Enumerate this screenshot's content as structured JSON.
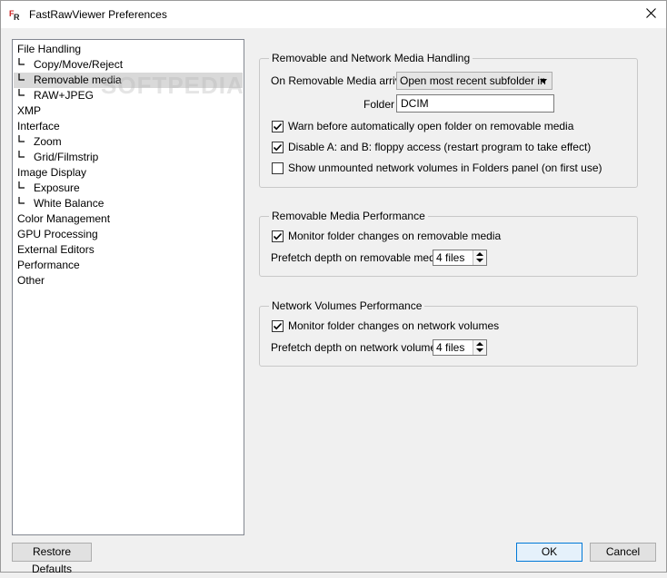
{
  "window": {
    "title": "FastRawViewer Preferences"
  },
  "icons": {
    "app": "fastrawviewer-app-icon",
    "close": "close-icon"
  },
  "watermark": "SOFTPEDIA",
  "nav": {
    "items": [
      {
        "label": "File Handling",
        "prefix": ""
      },
      {
        "label": "Copy/Move/Reject",
        "prefix": "L▸"
      },
      {
        "label": "Removable media",
        "prefix": "L▸"
      },
      {
        "label": "RAW+JPEG",
        "prefix": "L▸"
      },
      {
        "label": "XMP",
        "prefix": ""
      },
      {
        "label": "Interface",
        "prefix": ""
      },
      {
        "label": "Zoom",
        "prefix": "L▸"
      },
      {
        "label": "Grid/Filmstrip",
        "prefix": "L▸"
      },
      {
        "label": "Image Display",
        "prefix": ""
      },
      {
        "label": "Exposure",
        "prefix": "L▸"
      },
      {
        "label": "White Balance",
        "prefix": "L▸"
      },
      {
        "label": "Color Management",
        "prefix": ""
      },
      {
        "label": "GPU Processing",
        "prefix": ""
      },
      {
        "label": "External Editors",
        "prefix": ""
      },
      {
        "label": "Performance",
        "prefix": ""
      },
      {
        "label": "Other",
        "prefix": ""
      }
    ]
  },
  "group1": {
    "title": "Removable and Network Media Handling",
    "arrive_label": "On Removable Media arrive",
    "arrive_value": "Open most recent subfolder in",
    "folder_label": "Folder",
    "folder_value": "DCIM",
    "checks": [
      {
        "label": "Warn before automatically open folder on removable media",
        "checked": true
      },
      {
        "label": "Disable A: and B: floppy access (restart program to take effect)",
        "checked": true
      },
      {
        "label": "Show unmounted network volumes in Folders panel (on first use)",
        "checked": false
      }
    ]
  },
  "group2": {
    "title": "Removable Media Performance",
    "monitor_label": "Monitor folder changes on removable media",
    "monitor_checked": true,
    "prefetch_label": "Prefetch depth on removable media",
    "prefetch_value": "4 files"
  },
  "group3": {
    "title": "Network Volumes Performance",
    "monitor_label": "Monitor folder changes on network volumes",
    "monitor_checked": true,
    "prefetch_label": "Prefetch depth on network volumes",
    "prefetch_value": "4 files"
  },
  "buttons": {
    "restore": "Restore Defaults",
    "ok": "OK",
    "cancel": "Cancel"
  }
}
